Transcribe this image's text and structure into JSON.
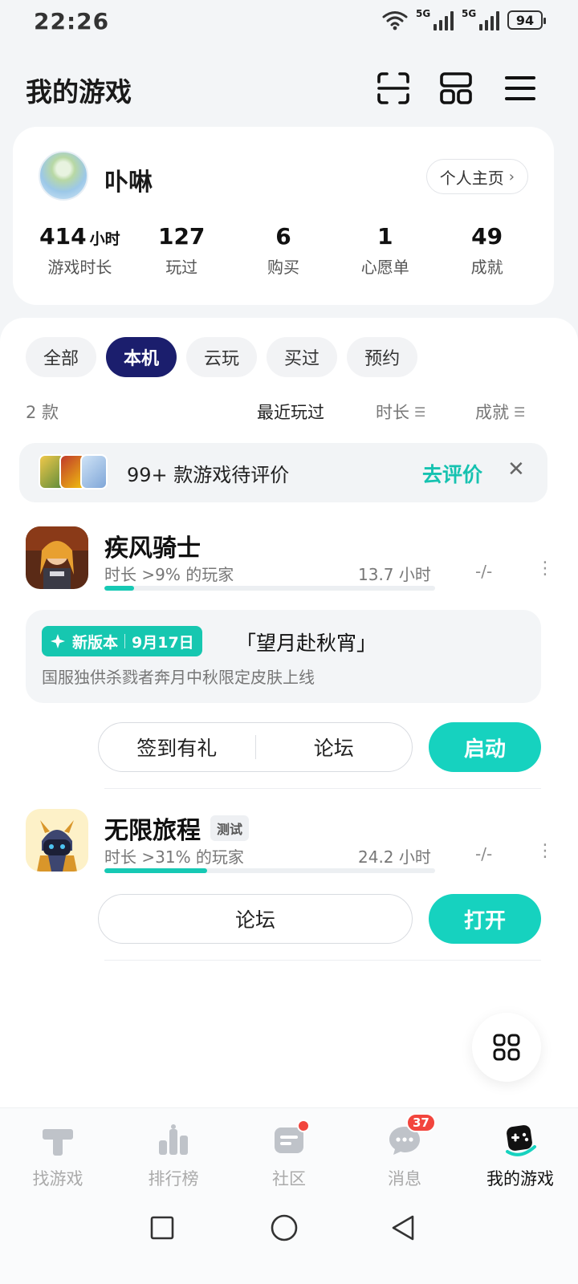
{
  "status_bar": {
    "time": "22:26",
    "network1": "5G",
    "network2": "5G",
    "battery": "94"
  },
  "header": {
    "title": "我的游戏"
  },
  "profile": {
    "username": "卟啉",
    "homepage_label": "个人主页",
    "stats": [
      {
        "value": "414",
        "unit": "小时",
        "label": "游戏时长"
      },
      {
        "value": "127",
        "unit": "",
        "label": "玩过"
      },
      {
        "value": "6",
        "unit": "",
        "label": "购买"
      },
      {
        "value": "1",
        "unit": "",
        "label": "心愿单"
      },
      {
        "value": "49",
        "unit": "",
        "label": "成就"
      }
    ]
  },
  "filters": {
    "items": [
      "全部",
      "本机",
      "云玩",
      "买过",
      "预约"
    ],
    "active": "本机"
  },
  "sort_bar": {
    "count": "2 款",
    "recent": "最近玩过",
    "duration": "时长",
    "achievements": "成就"
  },
  "review_banner": {
    "text": "99+ 款游戏待评价",
    "action": "去评价"
  },
  "games": [
    {
      "name": "疾风骑士",
      "badge": "",
      "rank_text": "时长 >9% 的玩家",
      "hours": "13.7 小时",
      "achievements": "-/-",
      "progress": 0.09,
      "news": {
        "tag": "新版本",
        "date": "9月17日",
        "title": "「望月赴秋宵」",
        "subtitle": "国服独供杀戮者奔月中秋限定皮肤上线"
      },
      "actions": [
        "签到有礼",
        "论坛"
      ],
      "primary": "启动"
    },
    {
      "name": "无限旅程",
      "badge": "测试",
      "rank_text": "时长 >31% 的玩家",
      "hours": "24.2 小时",
      "achievements": "-/-",
      "progress": 0.31,
      "actions": [
        "论坛"
      ],
      "primary": "打开"
    }
  ],
  "bottom_nav": [
    {
      "label": "找游戏",
      "icon": "discover-icon"
    },
    {
      "label": "排行榜",
      "icon": "ranking-icon"
    },
    {
      "label": "社区",
      "icon": "community-icon"
    },
    {
      "label": "消息",
      "icon": "message-icon",
      "badge": "37"
    },
    {
      "label": "我的游戏",
      "icon": "gamepad-icon"
    }
  ],
  "colors": {
    "accent": "#16d2bf",
    "chip_active": "#1b1e6d",
    "badge_red": "#f2453d"
  }
}
